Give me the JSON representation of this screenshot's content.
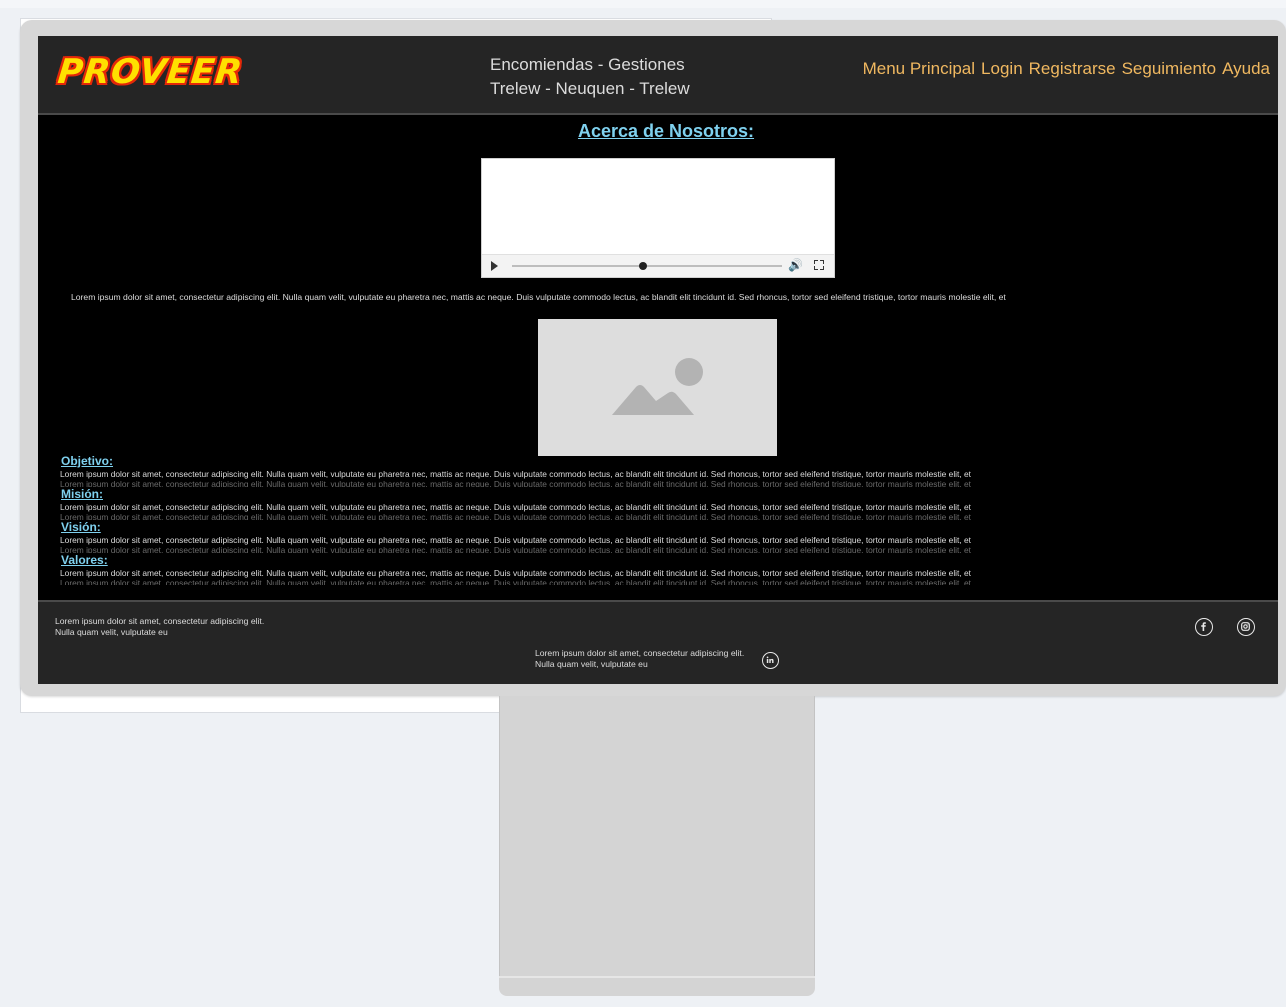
{
  "header": {
    "logo": "PROVEER",
    "tagline_line1": "Encomiendas - Gestiones",
    "tagline_line2": "Trelew - Neuquen - Trelew",
    "nav": [
      "Menu Principal",
      "Login",
      "Registrarse",
      "Seguimiento",
      "Ayuda"
    ]
  },
  "main": {
    "title": "Acerca de Nosotros:",
    "intro": "Lorem ipsum dolor sit amet, consectetur adipiscing elit. Nulla quam velit, vulputate eu pharetra nec, mattis ac neque. Duis vulputate commodo lectus, ac blandit elit tincidunt id. Sed rhoncus, tortor sed eleifend tristique, tortor mauris molestie elit, et",
    "sections": [
      {
        "title": "Objetivo:",
        "text": "Lorem ipsum dolor sit amet, consectetur adipiscing elit. Nulla quam velit, vulputate eu pharetra nec, mattis ac neque. Duis vulputate commodo lectus, ac blandit elit tincidunt id. Sed rhoncus, tortor sed eleifend tristique, tortor mauris molestie elit, et"
      },
      {
        "title": "Misión:",
        "text": "Lorem ipsum dolor sit amet, consectetur adipiscing elit. Nulla quam velit, vulputate eu pharetra nec, mattis ac neque. Duis vulputate commodo lectus, ac blandit elit tincidunt id. Sed rhoncus, tortor sed eleifend tristique, tortor mauris molestie elit, et"
      },
      {
        "title": "Visión:",
        "text": "Lorem ipsum dolor sit amet, consectetur adipiscing elit. Nulla quam velit, vulputate eu pharetra nec, mattis ac neque. Duis vulputate commodo lectus, ac blandit elit tincidunt id. Sed rhoncus, tortor sed eleifend tristique, tortor mauris molestie elit, et"
      },
      {
        "title": "Valores:",
        "text": "Lorem ipsum dolor sit amet, consectetur adipiscing elit. Nulla quam velit, vulputate eu pharetra nec, mattis ac neque. Duis vulputate commodo lectus, ac blandit elit tincidunt id. Sed rhoncus, tortor sed eleifend tristique, tortor mauris molestie elit, et"
      }
    ]
  },
  "footer": {
    "left_text": "Lorem ipsum dolor sit amet, consectetur adipiscing elit. Nulla quam velit, vulputate eu",
    "center_text": "Lorem ipsum dolor sit amet, consectetur adipiscing elit. Nulla quam velit, vulputate eu",
    "social": [
      "facebook-icon",
      "instagram-icon",
      "linkedin-icon"
    ]
  },
  "colors": {
    "accent_link": "#7fd1ef",
    "nav_link": "#f0b860",
    "logo_fill": "#ffe000",
    "logo_outline": "#e52808",
    "header_bg": "#252525",
    "page_bg": "#000000"
  }
}
